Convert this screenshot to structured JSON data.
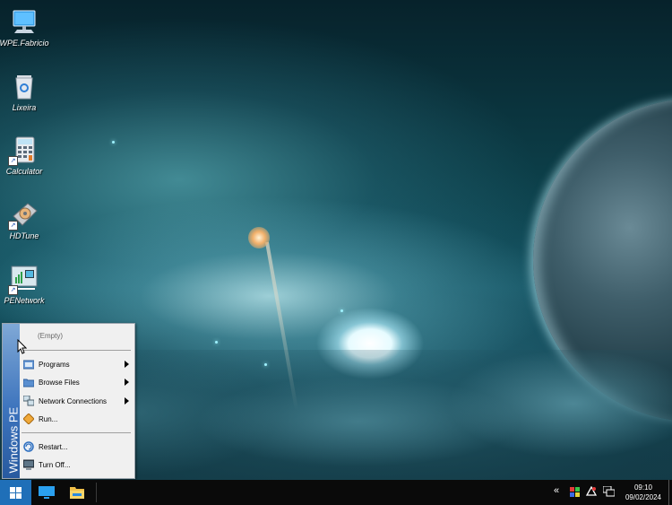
{
  "desktop": {
    "icons": [
      {
        "label": "WPE.Fabricio",
        "icon": "computer-icon"
      },
      {
        "label": "Lixeira",
        "icon": "recycle-bin-icon"
      },
      {
        "label": "Calculator",
        "icon": "calculator-icon"
      },
      {
        "label": "HDTune",
        "icon": "hard-disk-icon"
      },
      {
        "label": "PENetwork",
        "icon": "network-icon"
      }
    ]
  },
  "start_menu": {
    "banner": "Windows PE",
    "recent_empty": "(Empty)",
    "items": [
      {
        "label": "Programs",
        "icon": "folder-programs-icon",
        "submenu": true
      },
      {
        "label": "Browse Files",
        "icon": "folder-icon",
        "submenu": true
      },
      {
        "label": "Network Connections",
        "icon": "network-connections-icon",
        "submenu": true
      },
      {
        "label": "Run...",
        "icon": "run-icon",
        "submenu": false
      }
    ],
    "power_items": [
      {
        "label": "Restart...",
        "icon": "restart-icon"
      },
      {
        "label": "Turn Off...",
        "icon": "shutdown-icon"
      }
    ]
  },
  "taskbar": {
    "pinned": [
      {
        "icon": "desktop-monitor-icon"
      },
      {
        "icon": "file-explorer-icon"
      }
    ],
    "tray": {
      "chevron": "«",
      "time": "09:10",
      "date": "09/02/2024"
    }
  }
}
